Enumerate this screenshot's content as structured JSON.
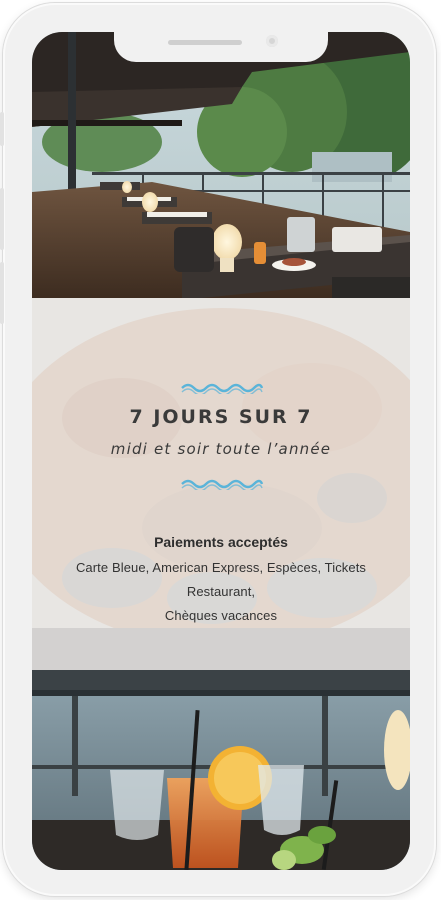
{
  "info": {
    "title": "7 JOURS SUR 7",
    "subtitle": "midi et soir toute l’année",
    "payments_title": "Paiements acceptés",
    "payments_lines": [
      "Carte Bleue, American Express, Espèces, Tickets",
      "Restaurant,",
      "Chèques vacances"
    ]
  },
  "colors": {
    "wave_accent": "#5ab4d9",
    "panel_overlay": "#efefef",
    "text_dark": "#3a3a3a"
  },
  "images": {
    "top": "restaurant-terrace-photo",
    "middle_background": "seafood-platter-photo",
    "bottom": "cocktail-drinks-photo"
  }
}
